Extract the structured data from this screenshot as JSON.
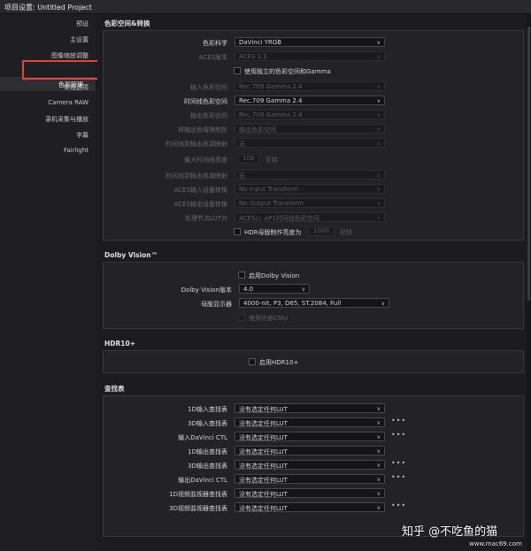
{
  "window": {
    "title": "项目设置:  Untitled Project"
  },
  "sidebar": {
    "items": [
      "预设",
      "主设置",
      "图像缩放调整",
      "色彩管理",
      "常规选项",
      "Camera RAW",
      "录机采集与播放",
      "字幕",
      "Fairlight"
    ],
    "active": "色彩管理"
  },
  "color_space": {
    "title": "色彩空间&转换",
    "rows": [
      {
        "label": "色彩科学",
        "value": "DaVinci YRGB",
        "enabled": true
      },
      {
        "label": "ACES版本",
        "value": "ACES 1.1",
        "enabled": false
      },
      {
        "label": "使用独立的色彩空间和Gamma",
        "checkbox": true,
        "enabled": true
      },
      {
        "label": "输入色彩空间",
        "value": "Rec.709 Gamma 2.4",
        "enabled": false
      },
      {
        "label": "时间线色彩空间",
        "value": "Rec.709 Gamma 2.4",
        "enabled": true
      },
      {
        "label": "输出色彩空间",
        "value": "Rec.709 Gamma 2.4",
        "enabled": false
      },
      {
        "label": "将输出色域限制在",
        "value": "输出色彩空间",
        "enabled": false
      },
      {
        "label": "时间线到输出色调映射",
        "value": "无",
        "enabled": false
      },
      {
        "label": "最大时间线亮度",
        "number": "100",
        "unit": "尼特",
        "enabled": false
      },
      {
        "label": "时间线到输出色域映射",
        "value": "无",
        "enabled": false
      },
      {
        "label": "ACES输入设备转换",
        "value": "No Input Transform",
        "enabled": false
      },
      {
        "label": "ACES输出设备转换",
        "value": "No Output Transform",
        "enabled": false
      },
      {
        "label": "处理节点LUT为",
        "value": "ACEScc AP1时间线色彩空间",
        "enabled": false
      }
    ],
    "hdr": {
      "label": "HDR母版制作亮度为",
      "value": "1000",
      "unit": "尼特"
    }
  },
  "dolby": {
    "title": "Dolby Vision™",
    "enable_label": "启用Dolby Vision",
    "version_label": "Dolby Vision版本",
    "version_value": "4.0",
    "display_label": "母版显示器",
    "display_value": "4000-nit, P3, D65, ST.2084, Full",
    "cmu_label": "使用外部CMU"
  },
  "hdr10": {
    "title": "HDR10+",
    "enable_label": "启用HDR10+"
  },
  "lut": {
    "title": "查找表",
    "rows": [
      {
        "label": "1D输入查找表",
        "value": "没有选定任何LUT",
        "more": false
      },
      {
        "label": "3D输入查找表",
        "value": "没有选定任何LUT",
        "more": true
      },
      {
        "label": "输入DaVinci CTL",
        "value": "没有选定任何LUT",
        "more": true
      },
      {
        "label": "1D输出查找表",
        "value": "没有选定任何LUT",
        "more": false
      },
      {
        "label": "3D输出查找表",
        "value": "没有选定任何LUT",
        "more": true
      },
      {
        "label": "输出DaVinci CTL",
        "value": "没有选定任何LUT",
        "more": true
      },
      {
        "label": "1D视频监视器查找表",
        "value": "没有选定任何LUT",
        "more": false
      },
      {
        "label": "3D视频监视器查找表",
        "value": "没有选定任何LUT",
        "more": true
      }
    ]
  },
  "watermark": {
    "text": "知乎 @不吃鱼的猫",
    "site": "www.mac69.com"
  }
}
